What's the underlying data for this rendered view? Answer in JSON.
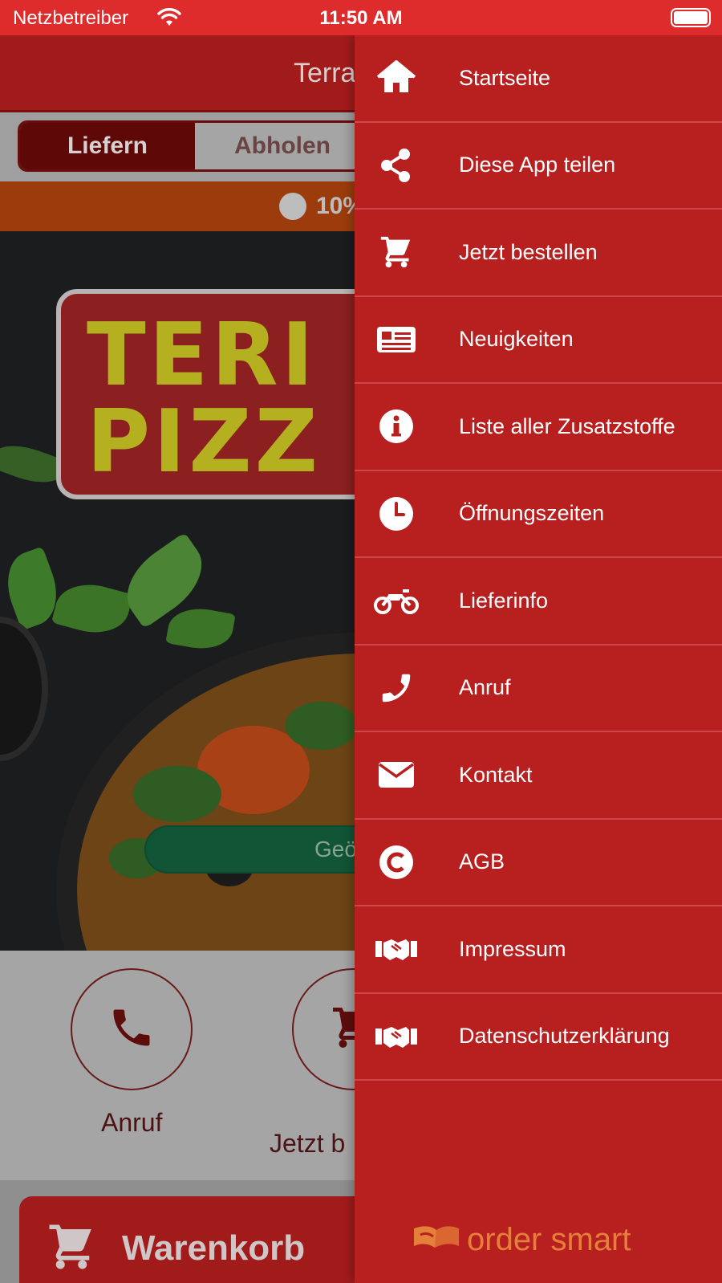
{
  "status_bar": {
    "carrier": "Netzbetreiber",
    "time": "11:50 AM",
    "wifi_icon": "wifi-icon",
    "battery_icon": "battery-icon"
  },
  "app": {
    "header_title": "Terra",
    "segment": {
      "options": [
        "Liefern",
        "Abholen"
      ],
      "selected": "Liefern"
    },
    "promo_text": "10%",
    "logo_lines": [
      "TERI",
      "PIZZ"
    ],
    "open_status": "Geö",
    "actions": [
      {
        "label": "Anruf",
        "icon": "phone-icon"
      },
      {
        "label": "Jetzt b",
        "icon": "cart-icon"
      }
    ],
    "cart_button": "Warenkorb"
  },
  "drawer": {
    "items": [
      {
        "label": "Startseite",
        "icon": "home-icon"
      },
      {
        "label": "Diese App teilen",
        "icon": "share-icon"
      },
      {
        "label": "Jetzt bestellen",
        "icon": "cart-icon"
      },
      {
        "label": "Neuigkeiten",
        "icon": "newspaper-icon"
      },
      {
        "label": "Liste aller Zusatzstoffe",
        "icon": "info-icon"
      },
      {
        "label": "Öffnungszeiten",
        "icon": "clock-icon"
      },
      {
        "label": "Lieferinfo",
        "icon": "motorcycle-icon"
      },
      {
        "label": "Anruf",
        "icon": "phone-icon"
      },
      {
        "label": "Kontakt",
        "icon": "envelope-icon"
      },
      {
        "label": "AGB",
        "icon": "copyright-icon"
      },
      {
        "label": "Impressum",
        "icon": "handshake-icon"
      },
      {
        "label": "Datenschutzerklärung",
        "icon": "handshake-icon"
      }
    ],
    "brand": "order smart"
  },
  "colors": {
    "status_bar": "#de2b2b",
    "drawer": "#b81f1f",
    "drawer_divider": "#cc4747",
    "brand_orange": "#e5803a"
  }
}
